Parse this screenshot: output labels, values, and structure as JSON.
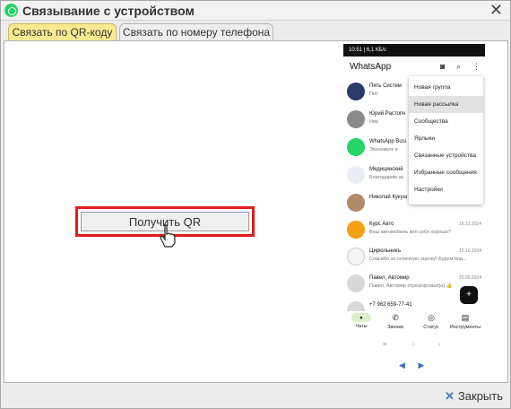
{
  "window": {
    "title": "Связывание с устройством",
    "close_icon": "close-icon"
  },
  "tabs": [
    {
      "label": "Связать по QR-коду",
      "active": true
    },
    {
      "label": "Связать по номеру телефона",
      "active": false
    }
  ],
  "main": {
    "qr_button_label": "Получить QR",
    "highlight_color": "#e01b1b"
  },
  "phone": {
    "status_bar": "10:51 | 6,1 КБ/с",
    "app_title": "WhatsApp",
    "header_icons": [
      "camera-icon",
      "search-icon",
      "more-icon"
    ],
    "chats": [
      {
        "name": "Пять Систем",
        "message": "Пит",
        "date": ""
      },
      {
        "name": "Юрий Растопч",
        "message": "Ива",
        "date": ""
      },
      {
        "name": "WhatsApp Busi",
        "message": "Экономьте в",
        "date": ""
      },
      {
        "name": "Медицинский",
        "message": "Благодарим за",
        "date": ""
      },
      {
        "name": "Николай Кукуш",
        "message": "",
        "date": ""
      },
      {
        "name": "Курс Авто",
        "message": "Ваш автомобиль вел себя хорошо?",
        "date": "16.12.2024"
      },
      {
        "name": "Цирюльникъ",
        "message": "Спасибо за отличную оценку! Будем бла...",
        "date": "10.10.2024"
      },
      {
        "name": "Павел, Автомир",
        "message": "Павел, Автомир отреагировал(а) 👍",
        "date": "20.09.2024"
      },
      {
        "name": "+7 962 659-77-41",
        "message": "",
        "date": ""
      }
    ],
    "menu": [
      {
        "label": "Новая группа",
        "selected": false
      },
      {
        "label": "Новая рассылка",
        "selected": true
      },
      {
        "label": "Сообщества",
        "selected": false
      },
      {
        "label": "Ярлыки",
        "selected": false
      },
      {
        "label": "Связанные устройства",
        "selected": false
      },
      {
        "label": "Избранные сообщения",
        "selected": false
      },
      {
        "label": "Настройки",
        "selected": false
      }
    ],
    "bottom_nav": [
      "Чаты",
      "Звонки",
      "Статус",
      "Инструменты"
    ]
  },
  "footer": {
    "close_label": "Закрыть"
  }
}
